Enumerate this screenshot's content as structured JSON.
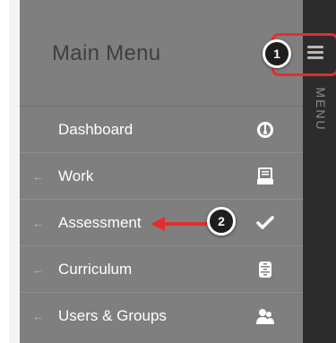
{
  "menu": {
    "title": "Main Menu",
    "items": [
      {
        "label": "Dashboard",
        "has_arrow": false,
        "icon": "dashboard-gauge-icon"
      },
      {
        "label": "Work",
        "has_arrow": true,
        "arrow": "←",
        "icon": "work-tray-icon"
      },
      {
        "label": "Assessment",
        "has_arrow": true,
        "arrow": "←",
        "icon": "checkmark-icon"
      },
      {
        "label": "Curriculum",
        "has_arrow": true,
        "arrow": "←",
        "icon": "curriculum-cabinet-icon"
      },
      {
        "label": "Users & Groups",
        "has_arrow": true,
        "arrow": "←",
        "icon": "users-groups-icon"
      }
    ]
  },
  "sidebar": {
    "toggle_icon": "hamburger-icon",
    "vertical_label": "MENU"
  },
  "annotations": {
    "callout_1": "1",
    "callout_2": "2",
    "highlight_color": "#e32d2d"
  },
  "colors": {
    "panel_bg": "#7f7f7f",
    "sidebar_bg": "#2c2c2c",
    "title_color": "#3f3f3f",
    "item_text": "#ffffff"
  }
}
